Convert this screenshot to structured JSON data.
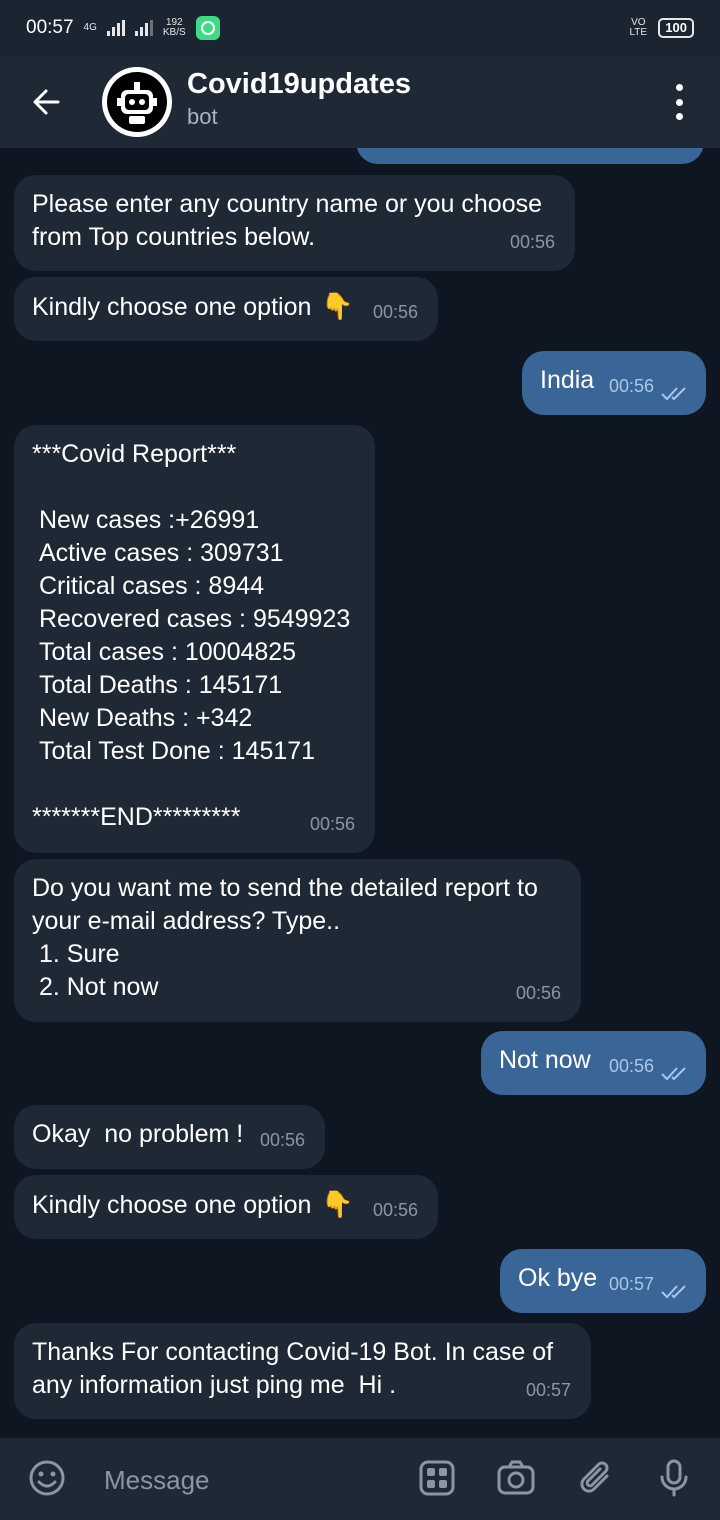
{
  "status_bar": {
    "time": "00:57",
    "network": "4G",
    "speed_value": "192",
    "speed_unit": "KB/S",
    "volte": "VO LTE",
    "battery": "100"
  },
  "header": {
    "title": "Covid19updates",
    "subtitle": "bot"
  },
  "messages": [
    {
      "type": "in",
      "text": "Please enter any country name or you choose\nfrom Top countries below.",
      "time": "00:56"
    },
    {
      "type": "in",
      "text": "Kindly choose one option",
      "emoji": "👇",
      "time": "00:56"
    },
    {
      "type": "out",
      "text": "India",
      "time": "00:56"
    },
    {
      "type": "in",
      "text": "***Covid Report***\n\n New cases :+26991\n Active cases : 309731\n Critical cases : 8944\n Recovered cases : 9549923\n Total cases : 10004825\n Total Deaths : 145171\n New Deaths : +342\n Total Test Done : 145171\n\n*******END*********",
      "time": "00:56"
    },
    {
      "type": "in",
      "text": "Do you want me to send the detailed report to\nyour e-mail address? Type..\n 1. Sure\n 2. Not now",
      "time": "00:56"
    },
    {
      "type": "out",
      "text": "Not now",
      "time": "00:56"
    },
    {
      "type": "in",
      "text": "Okay  no problem !",
      "time": "00:56"
    },
    {
      "type": "in",
      "text": "Kindly choose one option",
      "emoji": "👇",
      "time": "00:56"
    },
    {
      "type": "out",
      "text": "Ok bye",
      "time": "00:57"
    },
    {
      "type": "in",
      "text": "Thanks For contacting Covid-19 Bot. In case of\nany information just ping me  Hi .",
      "time": "00:57"
    }
  ],
  "input": {
    "placeholder": "Message"
  },
  "icons": {
    "back": "arrow-left-icon",
    "menu": "more-vertical-icon",
    "emoji": "smiley-icon",
    "sticker": "grid-icon",
    "camera": "camera-icon",
    "attach": "paperclip-icon",
    "mic": "microphone-icon"
  },
  "colors": {
    "background": "#0e1621",
    "incoming_bubble": "#1f2936",
    "outgoing_bubble": "#3a6597",
    "header": "#1f2936"
  }
}
